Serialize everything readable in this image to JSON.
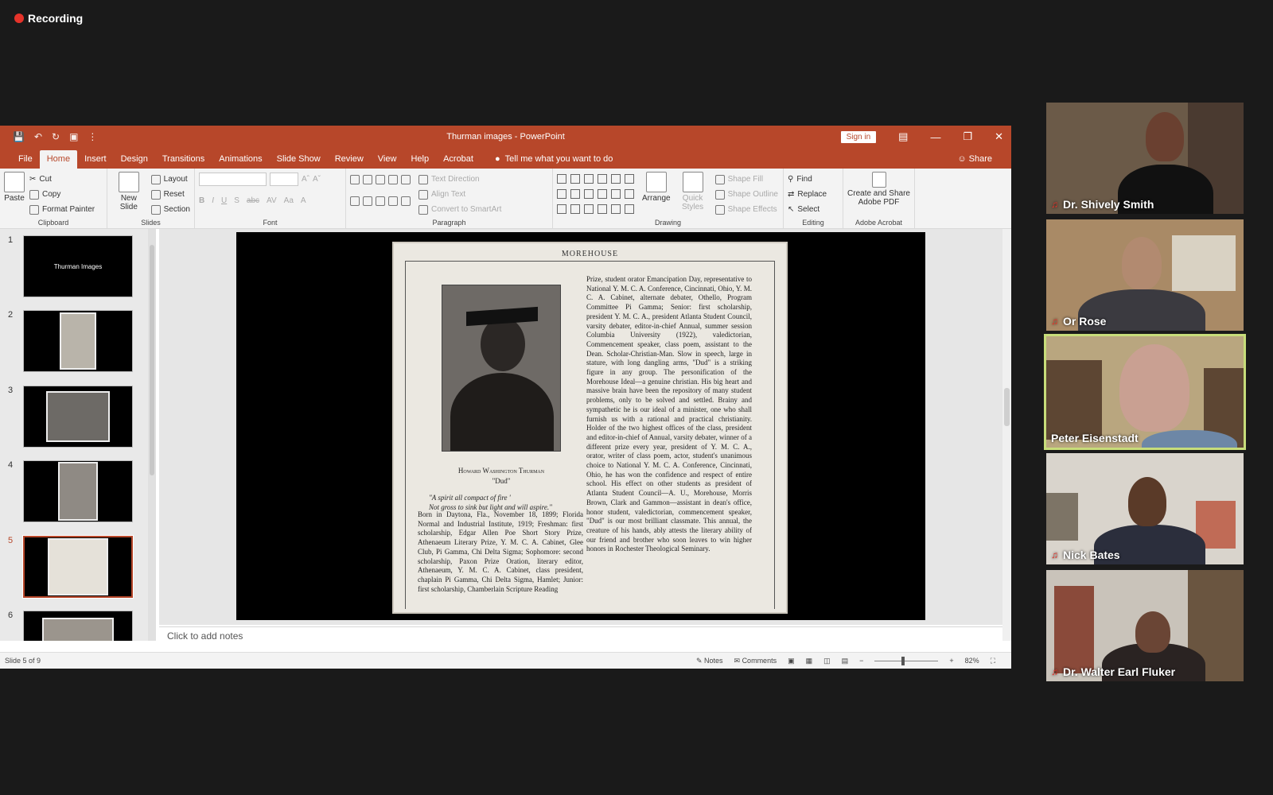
{
  "recording": {
    "label": "Recording"
  },
  "app": {
    "title": "Thurman images  -  PowerPoint",
    "sign_in": "Sign in",
    "tabs": [
      "File",
      "Home",
      "Insert",
      "Design",
      "Transitions",
      "Animations",
      "Slide Show",
      "Review",
      "View",
      "Help",
      "Acrobat"
    ],
    "active_tab": "Home",
    "tell_me": "Tell me what you want to do",
    "share": "Share"
  },
  "ribbon": {
    "clipboard": {
      "label": "Clipboard",
      "paste": "Paste",
      "cut": "Cut",
      "copy": "Copy",
      "format_painter": "Format Painter"
    },
    "slides": {
      "label": "Slides",
      "new_slide": "New Slide",
      "layout": "Layout",
      "reset": "Reset",
      "section": "Section"
    },
    "font": {
      "label": "Font"
    },
    "paragraph": {
      "label": "Paragraph",
      "text_direction": "Text Direction",
      "align_text": "Align Text",
      "convert_smartart": "Convert to SmartArt"
    },
    "drawing": {
      "label": "Drawing",
      "arrange": "Arrange",
      "quick_styles": "Quick Styles",
      "shape_fill": "Shape Fill",
      "shape_outline": "Shape Outline",
      "shape_effects": "Shape Effects"
    },
    "editing": {
      "label": "Editing",
      "find": "Find",
      "replace": "Replace",
      "select": "Select"
    },
    "acrobat": {
      "label": "Adobe Acrobat",
      "create_share": "Create and Share Adobe PDF"
    }
  },
  "thumbnails": [
    {
      "num": "1",
      "text": "Thurman Images"
    },
    {
      "num": "2",
      "text": ""
    },
    {
      "num": "3",
      "text": ""
    },
    {
      "num": "4",
      "text": ""
    },
    {
      "num": "5",
      "text": ""
    },
    {
      "num": "6",
      "text": ""
    }
  ],
  "selected_slide": 5,
  "slide": {
    "header": "MOREHOUSE",
    "caption_name": "Howard Washington Thurman",
    "caption_nick": "\"Dud\"",
    "quote": "\"A spirit all compact of fire '\nNot gross to sink but light and will aspire.\"",
    "left_text": "Born in Daytona, Fla., November 18, 1899; Florida Normal and Industrial Institute, 1919; Freshman: first scholarship, Edgar Allen Poe Short Story Prize, Athenaeum Literary Prize, Y. M. C. A. Cabinet, Glee Club, Pi Gamma, Chi Delta Sigma; Sophomore: second scholarship, Paxon Prize Oration, literary editor, Athenaeum, Y. M. C. A. Cabinet, class president, chaplain Pi Gamma, Chi Delta Sigma, Hamlet; Junior: first scholarship, Chamberlain Scripture Reading",
    "right_text": "Prize, student orator Emancipation Day, representative to National Y. M. C. A. Conference, Cincinnati, Ohio, Y. M. C. A. Cabinet, alternate debater, Othello, Program Committee Pi Gamma; Senior: first scholarship, president Y. M. C. A., president Atlanta Student Council, varsity debater, editor-in-chief Annual, summer session Columbia University (1922), valedictorian, Commencement speaker, class poem, assistant to the Dean. Scholar-Christian-Man. Slow in speech, large in stature, with long dangling arms, \"Dud\" is a striking figure in any group. The personification of the Morehouse Ideal—a genuine christian. His big heart and massive brain have been the repository of many student problems, only to be solved and settled. Brainy and sympathetic he is our ideal of a minister, one who shall furnish us with a rational and practical christianity. Holder of the two highest offices of the class, president and editor-in-chief of Annual, varsity debater, winner of a different prize every year, president of Y. M. C. A., orator, writer of class poem, actor, student's unanimous choice to National Y. M. C. A. Conference, Cincinnati, Ohio, he has won the confidence and respect of entire school. His effect on other students as president of Atlanta Student Council—A. U., Morehouse, Morris Brown, Clark and Gammon—assistant in dean's office, honor student, valedictorian, commencement speaker, \"Dud\" is our most brilliant classmate. This annual, the creature of his hands, ably attests the literary ability of our friend and brother who soon leaves to win higher honors in Rochester Theological Seminary."
  },
  "notes_placeholder": "Click to add notes",
  "status": {
    "slide_of": "Slide 5 of 9",
    "notes": "Notes",
    "comments": "Comments",
    "zoom": "82%"
  },
  "participants": [
    {
      "name": "Dr. Shively Smith",
      "muted": true
    },
    {
      "name": "Or Rose",
      "muted": true
    },
    {
      "name": "Peter Eisenstadt",
      "muted": false,
      "active": true
    },
    {
      "name": "Nick Bates",
      "muted": true
    },
    {
      "name": "Dr. Walter Earl Fluker",
      "muted": true
    }
  ]
}
